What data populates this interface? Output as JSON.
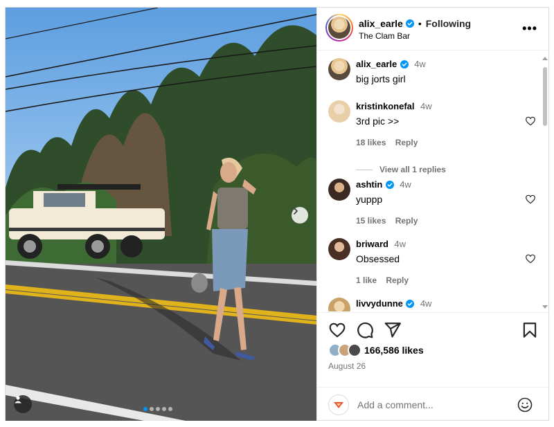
{
  "post": {
    "username": "alix_earle",
    "separator": "•",
    "follow_state": "Following",
    "location": "The Clam Bar",
    "more_label": "•••",
    "carousel_dots": 5,
    "carousel_active": 0
  },
  "caption": {
    "username": "alix_earle",
    "time": "4w",
    "text": "big jorts girl"
  },
  "comments": [
    {
      "username": "kristinkonefal",
      "verified": false,
      "time": "4w",
      "text": "3rd pic >>",
      "likes": "18 likes",
      "reply": "Reply"
    },
    {
      "username": "ashtin",
      "verified": true,
      "time": "4w",
      "text": "yuppp",
      "likes": "15 likes",
      "reply": "Reply"
    },
    {
      "username": "briward",
      "verified": false,
      "time": "4w",
      "text": "Obsessed",
      "likes": "1 like",
      "reply": "Reply"
    },
    {
      "username": "livvydunne",
      "verified": true,
      "time": "4w"
    }
  ],
  "view_replies": "View all 1 replies",
  "engagement": {
    "likes_text": "166,586 likes",
    "date": "August 26"
  },
  "add_comment": {
    "placeholder": "Add a comment..."
  },
  "colors": {
    "verified": "#0095f6",
    "muted": "#737373",
    "border": "#dbdbdb"
  },
  "icons": [
    "verified-badge-icon",
    "more-options-icon",
    "heart-icon",
    "comment-icon",
    "share-icon",
    "bookmark-icon",
    "emoji-icon",
    "chevron-right-icon",
    "user-tag-icon"
  ]
}
